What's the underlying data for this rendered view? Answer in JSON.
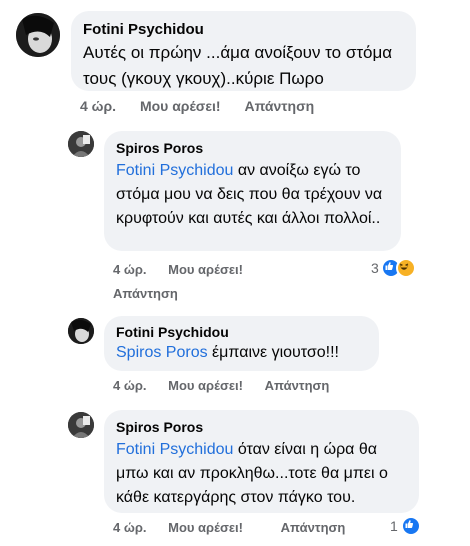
{
  "comments": [
    {
      "author": "Fotini Psychidou",
      "mention": "",
      "text": "Αυτές οι πρώην ...άμα ανοίξουν το στόμα τους  (γκουχ γκουχ)..κύριε Πωρο",
      "time": "4 ώρ.",
      "like": "Μου αρέσει!",
      "reply": "Απάντηση",
      "reaction_count": ""
    },
    {
      "author": "Spiros Poros",
      "mention": "Fotini Psychidou",
      "text": " αν ανοίξω εγώ το στόμα μου να δεις που θα τρέχουν να κρυφτούν και αυτές και  άλλοι πολλοί..",
      "time": "4 ώρ.",
      "like": "Μου αρέσει!",
      "reply": "Απάντηση",
      "reaction_count": "3"
    },
    {
      "author": "Fotini Psychidou",
      "mention": "Spiros Poros",
      "text": " έμπαινε γιουτσο!!!",
      "time": "4 ώρ.",
      "like": "Μου αρέσει!",
      "reply": "Απάντηση",
      "reaction_count": ""
    },
    {
      "author": "Spiros Poros",
      "mention": "Fotini Psychidou",
      "text": " όταν είναι η ώρα θα μπω και αν προκληθω...τοτε θα μπει ο κάθε κατεργάρης στον πάγκο του.",
      "time": "4 ώρ.",
      "like": "Μου αρέσει!",
      "reply": "Απάντηση",
      "reaction_count": "1"
    }
  ],
  "colors": {
    "bubble": "#f0f2f5",
    "mention": "#216fdb",
    "meta": "#65676b",
    "like": "#1877f2",
    "haha": "#f7b125"
  }
}
